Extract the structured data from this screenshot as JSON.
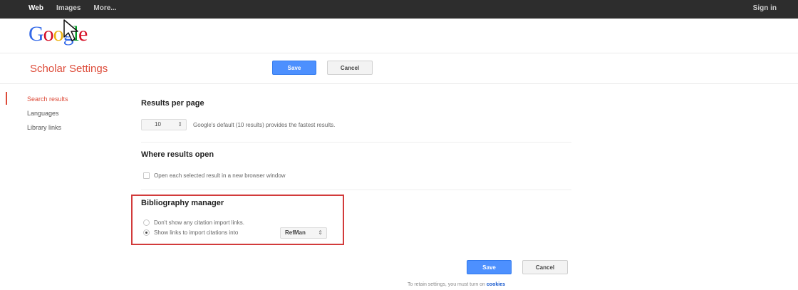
{
  "topbar": {
    "nav": [
      "Web",
      "Images",
      "More..."
    ],
    "signin": "Sign in"
  },
  "logo": {
    "letters": [
      "G",
      "o",
      "o",
      "g",
      "l",
      "e"
    ],
    "colors": [
      "#3369e8",
      "#d50f25",
      "#eeb211",
      "#3369e8",
      "#009925",
      "#d50f25"
    ]
  },
  "header": {
    "title": "Scholar Settings",
    "save_label": "Save",
    "cancel_label": "Cancel"
  },
  "sidebar": {
    "items": [
      "Search results",
      "Languages",
      "Library links"
    ],
    "active": "Search results"
  },
  "results_per_page": {
    "title": "Results per page",
    "value": "10",
    "note": "Google's default (10 results) provides the fastest results."
  },
  "where_results_open": {
    "title": "Where results open",
    "checkbox_label": "Open each selected result in a new browser window"
  },
  "bibliography": {
    "title": "Bibliography manager",
    "option_none": "Don't show any citation import links.",
    "option_show": "Show links to import citations into",
    "manager_value": "RefMan",
    "selected_option": "Show links to import citations into"
  },
  "footer": {
    "save_label": "Save",
    "cancel_label": "Cancel",
    "cookie_note": "To retain settings, you must turn on",
    "cookie_link": "cookies"
  },
  "colors": {
    "accent_red": "#dd4b39",
    "primary_blue": "#4d90fe",
    "highlight_red": "#d23b3b"
  }
}
